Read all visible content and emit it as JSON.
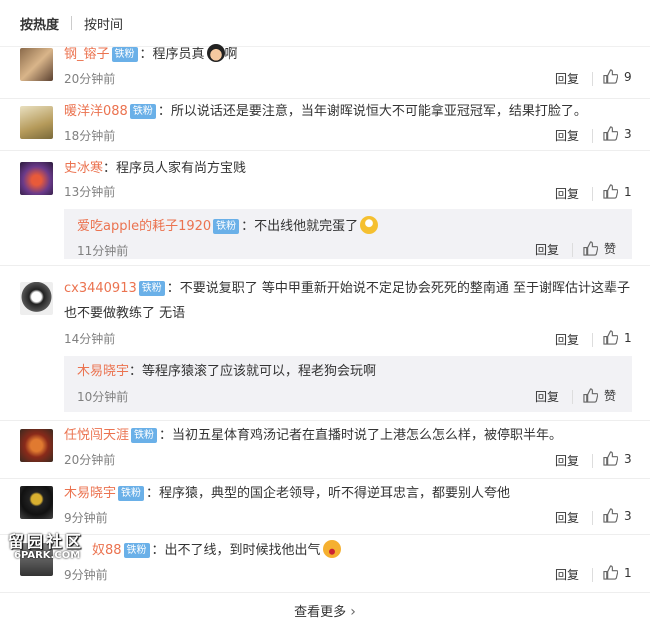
{
  "tabs": {
    "hot": "按热度",
    "time": "按时间"
  },
  "comments": [
    {
      "user": "钢_镕子",
      "badge": "铁粉",
      "text": "：程序员真",
      "time": "20分钟前",
      "reply": "回复",
      "likes": "9"
    },
    {
      "user": "暖洋洋088",
      "badge": "铁粉",
      "text": "：所以说话还是要注意，当年谢晖说恒大不可能拿亚冠冠军，结果打脸了。",
      "time": "18分钟前",
      "reply": "回复",
      "likes": "3"
    },
    {
      "user": "史冰寒",
      "text": "：程序员人家有尚方宝贱",
      "time": "13分钟前",
      "reply": "回复",
      "likes": "1",
      "sub": {
        "user": "爱吃apple的耗子1920",
        "badge": "铁粉",
        "text": "：不出线他就完蛋了",
        "time": "11分钟前",
        "reply": "回复",
        "likes": "赞"
      }
    },
    {
      "user": "cx3440913",
      "badge": "铁粉",
      "text": "：不要说复职了 等中甲重新开始说不定足协会死死的整南通 至于谢晖估计这辈子",
      "text2": "也不要做教练了 无语",
      "time": "14分钟前",
      "reply": "回复",
      "likes": "1",
      "sub": {
        "user": "木易晓宇",
        "text": "：等程序猿滚了应该就可以，程老狗会玩啊",
        "time": "10分钟前",
        "reply": "回复",
        "likes": "赞"
      }
    },
    {
      "user": "任悦闯天涯",
      "badge": "铁粉",
      "text": "：当初五星体育鸡汤记者在直播时说了上港怎么怎么样，被停职半年。",
      "time": "20分钟前",
      "reply": "回复",
      "likes": "3"
    },
    {
      "user": "木易晓宇",
      "badge": "铁粉",
      "text": "：程序猿，典型的国企老领导，听不得逆耳忠言，都要别人夸他",
      "time": "9分钟前",
      "reply": "回复",
      "likes": "3"
    },
    {
      "user": "奴88",
      "badge": "铁粉",
      "text": "：出不了线，到时候找他出气",
      "time": "9分钟前",
      "reply": "回复",
      "likes": "1"
    }
  ],
  "more": "查看更多",
  "watermark": {
    "line1": "留园社区",
    "line2": "6PARK.COM"
  }
}
